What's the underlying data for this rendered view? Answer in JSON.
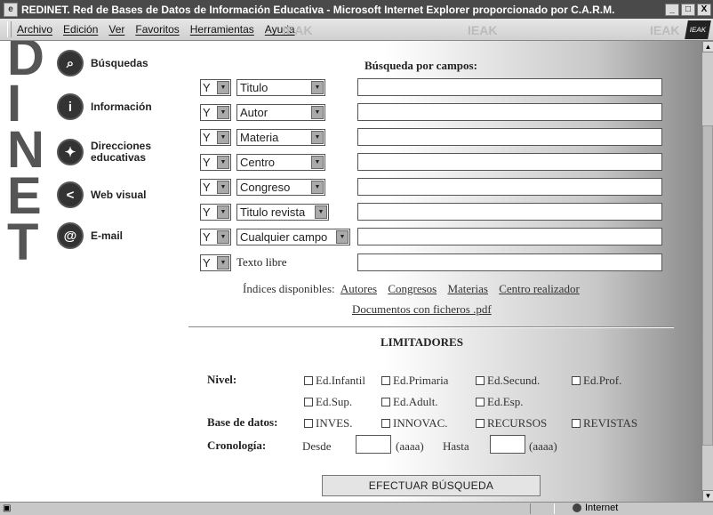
{
  "window": {
    "title": "REDINET. Red de Bases de Datos de Información Educativa - Microsoft Internet Explorer proporcionado por C.A.R.M.",
    "buttons": [
      "_",
      "□",
      "X"
    ]
  },
  "menubar": {
    "items": [
      "Archivo",
      "Edición",
      "Ver",
      "Favoritos",
      "Herramientas",
      "Ayuda"
    ],
    "watermark": "IEAK",
    "logo_text": "IEAK"
  },
  "sidebar": {
    "big_letters": [
      "D",
      "I",
      "N",
      "E",
      "T"
    ],
    "items": [
      {
        "label": "Búsquedas",
        "icon": "magnifier-icon",
        "glyph": "⌕"
      },
      {
        "label": "Información",
        "icon": "info-icon",
        "glyph": "i"
      },
      {
        "label": "Direcciones educativas",
        "icon": "network-icon",
        "glyph": "✦"
      },
      {
        "label": "Web visual",
        "icon": "share-icon",
        "glyph": "<"
      },
      {
        "label": "E-mail",
        "icon": "at-icon",
        "glyph": "@"
      }
    ]
  },
  "search": {
    "title": "Búsqueda por campos:",
    "rows": [
      {
        "op": "Y",
        "field": "Titulo",
        "value": ""
      },
      {
        "op": "Y",
        "field": "Autor",
        "value": ""
      },
      {
        "op": "Y",
        "field": "Materia",
        "value": ""
      },
      {
        "op": "Y",
        "field": "Centro",
        "value": ""
      },
      {
        "op": "Y",
        "field": "Congreso",
        "value": ""
      },
      {
        "op": "Y",
        "field": "Titulo revista",
        "value": ""
      },
      {
        "op": "Y",
        "field": "Cualquier campo",
        "value": ""
      }
    ],
    "free_text": {
      "op": "Y",
      "label": "Texto libre",
      "value": ""
    },
    "indices_label": "Índices disponibles:",
    "indices": [
      "Autores",
      "Congresos",
      "Materias",
      "Centro realizador"
    ],
    "docs_link": "Documentos con ficheros .pdf"
  },
  "limits": {
    "title": "LIMITADORES",
    "nivel_label": "Nivel:",
    "nivel": [
      "Ed.Infantil",
      "Ed.Primaria",
      "Ed.Secund.",
      "Ed.Prof.",
      "Ed.Sup.",
      "Ed.Adult.",
      "Ed.Esp."
    ],
    "base_label": "Base de datos:",
    "bases": [
      "INVES.",
      "INNOVAC.",
      "RECURSOS",
      "REVISTAS"
    ],
    "crono_label": "Cronología:",
    "desde": "Desde",
    "hasta": "Hasta",
    "format": "(aaaa)"
  },
  "submit_label": "EFECTUAR BÚSQUEDA",
  "status": {
    "zone": "Internet"
  }
}
